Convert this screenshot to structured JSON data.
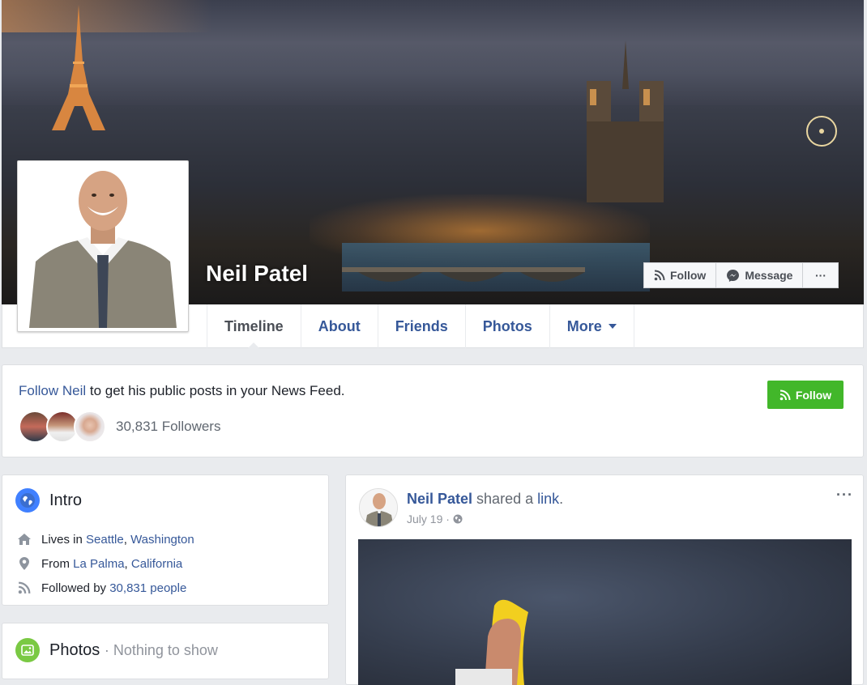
{
  "profile": {
    "name": "Neil Patel"
  },
  "cover_actions": {
    "follow_label": "Follow",
    "message_label": "Message",
    "more_label": "···"
  },
  "tabs": [
    {
      "label": "Timeline"
    },
    {
      "label": "About"
    },
    {
      "label": "Friends"
    },
    {
      "label": "Photos"
    },
    {
      "label": "More"
    }
  ],
  "follow_box": {
    "link_text": "Follow Neil",
    "message_rest": " to get his public posts in your News Feed.",
    "followers_count": "30,831 Followers",
    "button_label": "Follow"
  },
  "intro": {
    "title": "Intro",
    "lives_prefix": "Lives in ",
    "lives_city": "Seattle",
    "lives_sep": ", ",
    "lives_state": "Washington",
    "from_prefix": "From ",
    "from_city": "La Palma",
    "from_sep": ", ",
    "from_state": "California",
    "followed_prefix": "Followed by ",
    "followed_count": "30,831 people"
  },
  "photos_card": {
    "title": "Photos",
    "subtitle": "· Nothing to show"
  },
  "post": {
    "author": "Neil Patel",
    "action": " shared a ",
    "link_word": "link",
    "end": ".",
    "date": "July 19 ·",
    "more": "···"
  },
  "colors": {
    "link_blue": "#365899",
    "follow_green": "#42b72a",
    "page_bg": "#e9ebee"
  }
}
